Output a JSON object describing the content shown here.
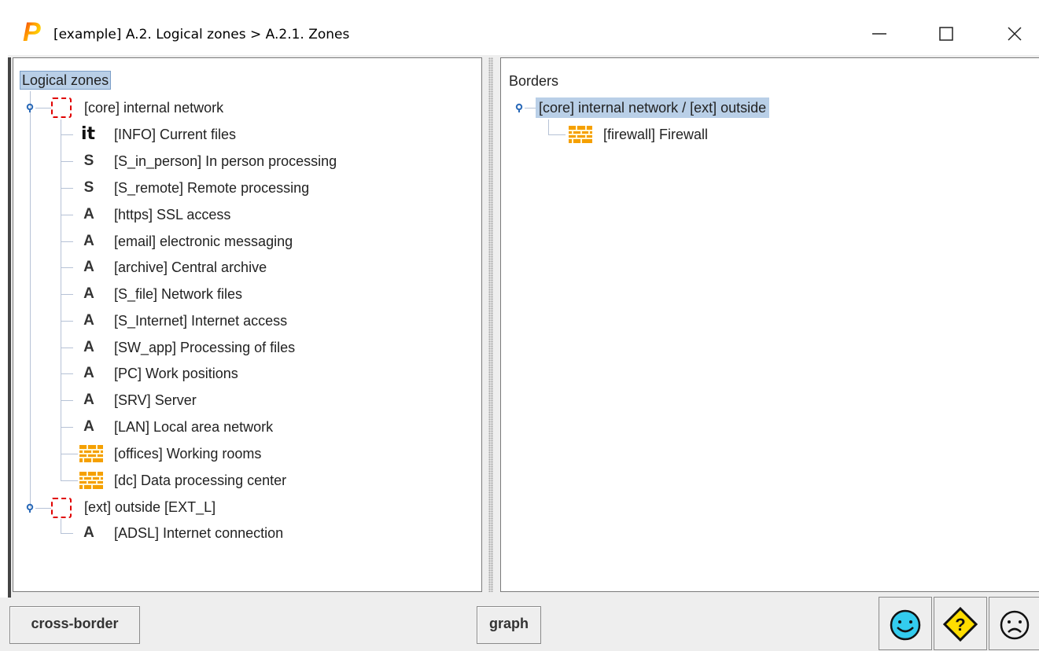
{
  "window": {
    "title": "[example] A.2. Logical zones > A.2.1. Zones",
    "logo_letter": "P",
    "controls": [
      "minimize-icon",
      "maximize-icon",
      "close-icon"
    ]
  },
  "left_tree": {
    "root": "Logical zones",
    "zones": [
      {
        "label": "[core] internal network",
        "icon": "zone-dashed-icon",
        "children": [
          {
            "glyph": "it",
            "label": "[INFO] Current files"
          },
          {
            "glyph": "S",
            "label": "[S_in_person] In person processing"
          },
          {
            "glyph": "S",
            "label": "[S_remote] Remote processing"
          },
          {
            "glyph": "A",
            "label": "[https] SSL access"
          },
          {
            "glyph": "A",
            "label": "[email] electronic messaging"
          },
          {
            "glyph": "A",
            "label": "[archive] Central archive"
          },
          {
            "glyph": "A",
            "label": "[S_file] Network files"
          },
          {
            "glyph": "A",
            "label": "[S_Internet] Internet access"
          },
          {
            "glyph": "A",
            "label": "[SW_app] Processing of files"
          },
          {
            "glyph": "A",
            "label": "[PC] Work positions"
          },
          {
            "glyph": "A",
            "label": "[SRV] Server"
          },
          {
            "glyph": "A",
            "label": "[LAN] Local area network"
          },
          {
            "glyph": "brick-wall-icon",
            "label": "[offices] Working rooms"
          },
          {
            "glyph": "brick-wall-icon",
            "label": "[dc] Data processing center"
          }
        ]
      },
      {
        "label": "[ext] outside [EXT_L]",
        "icon": "zone-dashed-icon",
        "children": [
          {
            "glyph": "A",
            "label": "[ADSL] Internet connection"
          }
        ]
      }
    ]
  },
  "right_tree": {
    "root": "Borders",
    "border": "[core] internal network / [ext] outside",
    "children": [
      {
        "glyph": "brick-wall-icon",
        "label": "[firewall] Firewall"
      }
    ]
  },
  "buttons": {
    "cross_border": "cross-border",
    "graph": "graph",
    "status_icons": [
      "smiley-happy-icon",
      "question-diamond-icon",
      "smiley-sad-icon"
    ]
  },
  "colors": {
    "selection": "#b9cfe7",
    "zone_border": "#e00000",
    "brick": "#f5a000",
    "happy": "#33ccee",
    "question": "#ffdd00"
  }
}
